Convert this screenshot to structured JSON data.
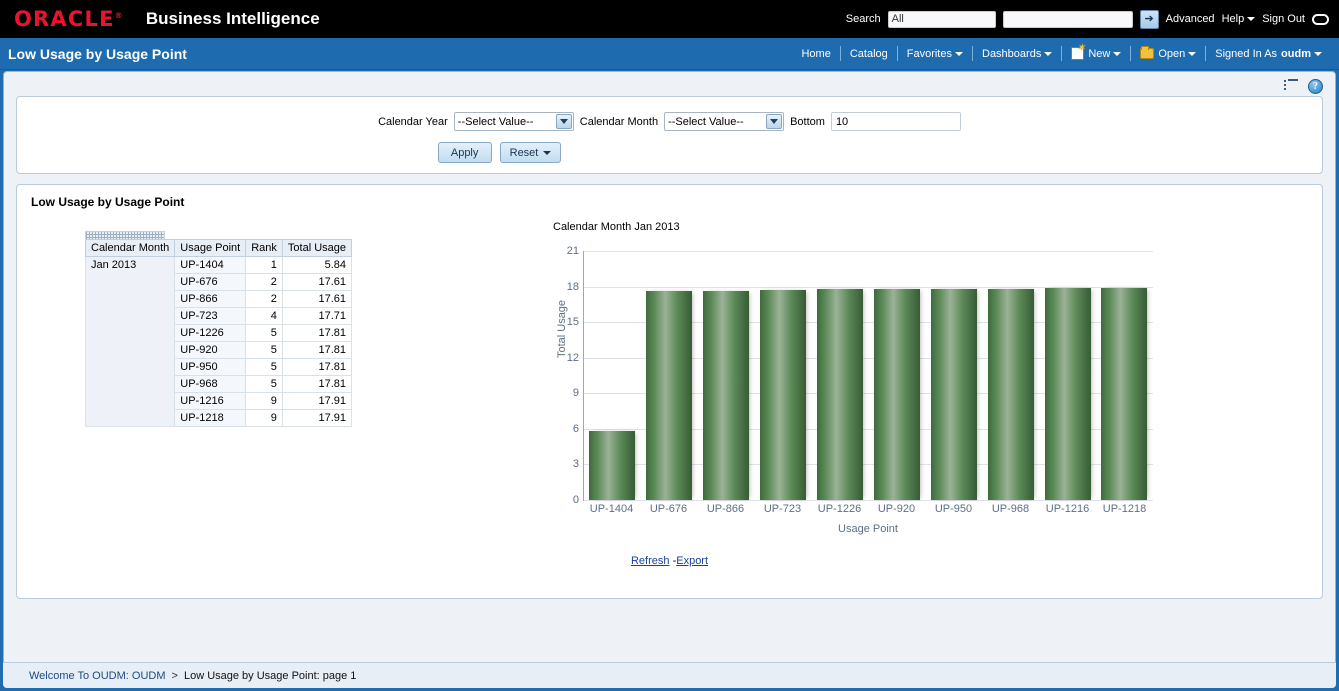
{
  "header": {
    "brand": "ORACLE",
    "app_title": "Business Intelligence",
    "search_label": "Search",
    "search_scope_value": "All",
    "search_input_value": "",
    "go_icon": "➔",
    "advanced_link": "Advanced",
    "help_link": "Help",
    "sign_out_link": "Sign Out"
  },
  "nav": {
    "page_heading": "Low Usage by Usage Point",
    "items": [
      {
        "label": "Home",
        "caret": false,
        "icon": null
      },
      {
        "label": "Catalog",
        "caret": false,
        "icon": null
      },
      {
        "label": "Favorites",
        "caret": true,
        "icon": null
      },
      {
        "label": "Dashboards",
        "caret": true,
        "icon": null
      },
      {
        "label": "New",
        "caret": true,
        "icon": "new-page-icon"
      },
      {
        "label": "Open",
        "caret": true,
        "icon": "folder-icon"
      }
    ],
    "signed_in_as_label": "Signed In As",
    "user": "oudm"
  },
  "toolbar": {
    "page_options_icon": "page-options-icon",
    "help_icon": "?"
  },
  "prompt": {
    "calendar_year_label": "Calendar Year",
    "calendar_year_value": "--Select Value--",
    "calendar_month_label": "Calendar Month",
    "calendar_month_value": "--Select Value--",
    "bottom_label": "Bottom",
    "bottom_value": "10",
    "apply_label": "Apply",
    "reset_label": "Reset"
  },
  "report": {
    "title": "Low Usage by Usage Point",
    "table": {
      "columns": [
        "Calendar Month",
        "Usage Point",
        "Rank",
        "Total Usage"
      ],
      "month": "Jan 2013",
      "rows": [
        {
          "usage_point": "UP-1404",
          "rank": "1",
          "total_usage": "5.84"
        },
        {
          "usage_point": "UP-676",
          "rank": "2",
          "total_usage": "17.61"
        },
        {
          "usage_point": "UP-866",
          "rank": "2",
          "total_usage": "17.61"
        },
        {
          "usage_point": "UP-723",
          "rank": "4",
          "total_usage": "17.71"
        },
        {
          "usage_point": "UP-1226",
          "rank": "5",
          "total_usage": "17.81"
        },
        {
          "usage_point": "UP-920",
          "rank": "5",
          "total_usage": "17.81"
        },
        {
          "usage_point": "UP-950",
          "rank": "5",
          "total_usage": "17.81"
        },
        {
          "usage_point": "UP-968",
          "rank": "5",
          "total_usage": "17.81"
        },
        {
          "usage_point": "UP-1216",
          "rank": "9",
          "total_usage": "17.91"
        },
        {
          "usage_point": "UP-1218",
          "rank": "9",
          "total_usage": "17.91"
        }
      ]
    },
    "refresh_link": "Refresh",
    "link_separator": "-",
    "export_link": "Export"
  },
  "chart_data": {
    "type": "bar",
    "title": "Calendar Month  Jan 2013",
    "categories": [
      "UP-1404",
      "UP-676",
      "UP-866",
      "UP-723",
      "UP-1226",
      "UP-920",
      "UP-950",
      "UP-968",
      "UP-1216",
      "UP-1218"
    ],
    "values": [
      5.84,
      17.61,
      17.61,
      17.71,
      17.81,
      17.81,
      17.81,
      17.81,
      17.91,
      17.91
    ],
    "series": [
      {
        "name": "Total Usage",
        "values": [
          5.84,
          17.61,
          17.61,
          17.71,
          17.81,
          17.81,
          17.81,
          17.81,
          17.91,
          17.91
        ]
      }
    ],
    "xlabel": "Usage Point",
    "ylabel": "Total Usage",
    "ylim": [
      0,
      21
    ],
    "yticks": [
      0,
      3,
      6,
      9,
      12,
      15,
      18,
      21
    ],
    "grid": true,
    "legend": false,
    "bar_color": "#4f7a4c"
  },
  "footer": {
    "home_link": "Welcome To OUDM: OUDM",
    "separator": ">",
    "current": "Low Usage by Usage Point: page 1"
  }
}
